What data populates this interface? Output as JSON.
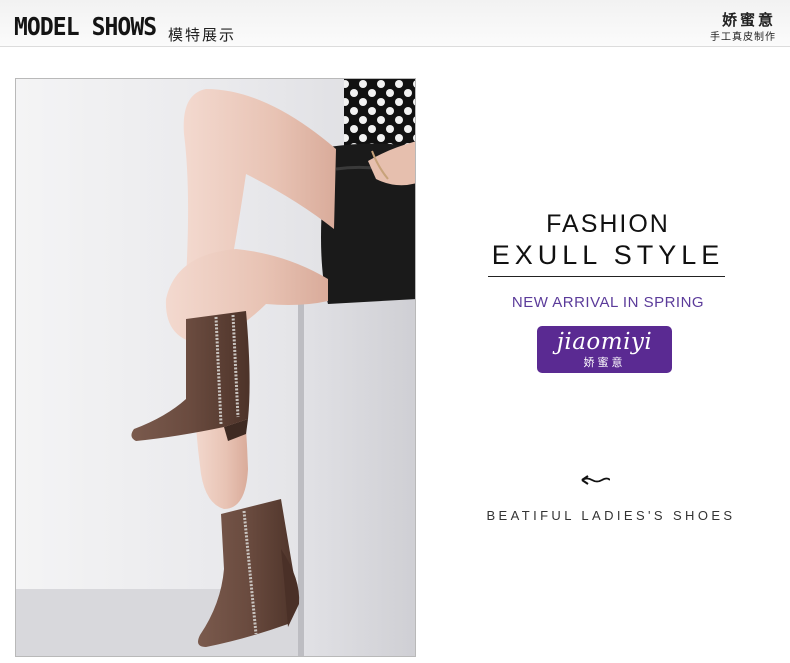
{
  "header": {
    "title_en": "MODEL SHOWS",
    "title_cn": "模特展示",
    "brand_cn": "娇蜜意",
    "brand_sub": "手工真皮制作"
  },
  "photo": {
    "alt": "model-wearing-brown-wedge-ankle-boots"
  },
  "promo": {
    "headline_1": "FASHION",
    "headline_2": "EXULL STYLE",
    "subtitle": "NEW ARRIVAL IN SPRING",
    "logo_script": "jiaomiyi",
    "logo_cn": "娇蜜意",
    "arrow_icon": "wavy-arrow-left-icon",
    "tagline": "BEATIFUL LADIES'S SHOES"
  },
  "colors": {
    "accent_purple": "#5a2a92",
    "subtitle_purple": "#5b3b9a",
    "boot_brown": "#6f4f43"
  }
}
